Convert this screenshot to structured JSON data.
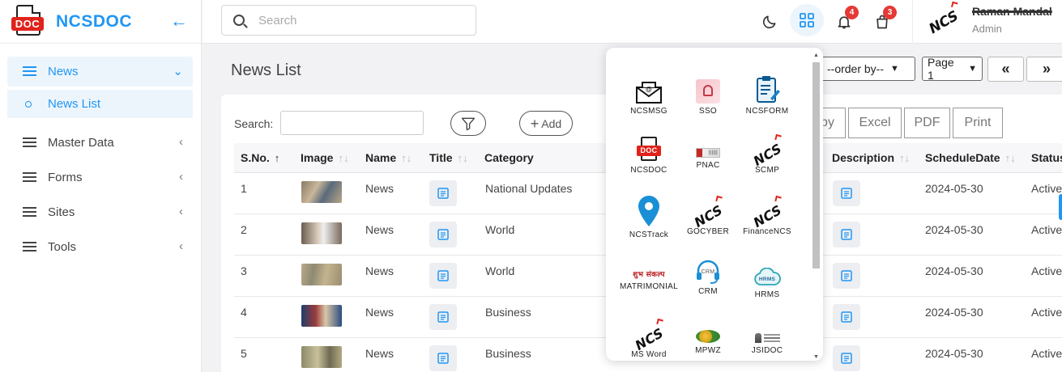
{
  "brand": {
    "name": "NCSDOC",
    "logo_text": "DOC"
  },
  "sidebar": {
    "items": [
      {
        "label": "News",
        "expanded": true
      },
      {
        "label": "News List",
        "sub": true
      },
      {
        "label": "Master Data"
      },
      {
        "label": "Forms"
      },
      {
        "label": "Sites"
      },
      {
        "label": "Tools"
      }
    ]
  },
  "topbar": {
    "search_placeholder": "Search",
    "notifications_count": "4",
    "cart_count": "3",
    "user_name": "Raman Mandal",
    "user_role": "Admin",
    "avatar_text": "NCS"
  },
  "main": {
    "title": "News List",
    "order_by": "--order by--",
    "page_select": "Page 1",
    "search_label": "Search:",
    "add_label": "Add",
    "export_buttons": [
      "py",
      "Excel",
      "PDF",
      "Print"
    ]
  },
  "table": {
    "headers": [
      "S.No.",
      "Image",
      "Name",
      "Title",
      "Category",
      "Description",
      "ScheduleDate",
      "Status"
    ],
    "rows": [
      {
        "sno": "1",
        "name": "News",
        "category": "National Updates",
        "date": "2024-05-30",
        "status": "Active"
      },
      {
        "sno": "2",
        "name": "News",
        "category": "World",
        "date": "2024-05-30",
        "status": "Active"
      },
      {
        "sno": "3",
        "name": "News",
        "category": "World",
        "date": "2024-05-30",
        "status": "Active"
      },
      {
        "sno": "4",
        "name": "News",
        "category": "Business",
        "date": "2024-05-30",
        "status": "Active"
      },
      {
        "sno": "5",
        "name": "News",
        "category": "Business",
        "date": "2024-05-30",
        "status": "Active"
      }
    ]
  },
  "apps": [
    {
      "label": "NCSMSG",
      "icon": "mail-icon"
    },
    {
      "label": "SSO",
      "icon": "touch-icon"
    },
    {
      "label": "NCSFORM",
      "icon": "form-icon"
    },
    {
      "label": "NCSDOC",
      "icon": "doc-icon"
    },
    {
      "label": "PNAC",
      "icon": "pnac-icon"
    },
    {
      "label": "SCMP",
      "icon": "ncs-logo-icon"
    },
    {
      "label": "NCSTrack",
      "icon": "location-pin-icon"
    },
    {
      "label": "GOCYBER",
      "icon": "ncs-logo-icon"
    },
    {
      "label": "FinanceNCS",
      "icon": "ncs-logo-icon"
    },
    {
      "label": "MATRIMONIAL",
      "icon": "matrimonial-icon",
      "icon_text": "शुभ संकल्प"
    },
    {
      "label": "CRM",
      "icon": "headset-icon",
      "icon_text": "CRM"
    },
    {
      "label": "HRMS",
      "icon": "cloud-icon",
      "icon_text": "HRMS"
    },
    {
      "label": "MS Word",
      "icon": "ncs-logo-icon"
    },
    {
      "label": "MPWZ",
      "icon": "mpwz-icon"
    },
    {
      "label": "JSIDOC",
      "icon": "emblem-icon"
    }
  ],
  "colors": {
    "accent": "#2196f3",
    "badge": "#e53935",
    "brand_red": "#e0231b"
  }
}
